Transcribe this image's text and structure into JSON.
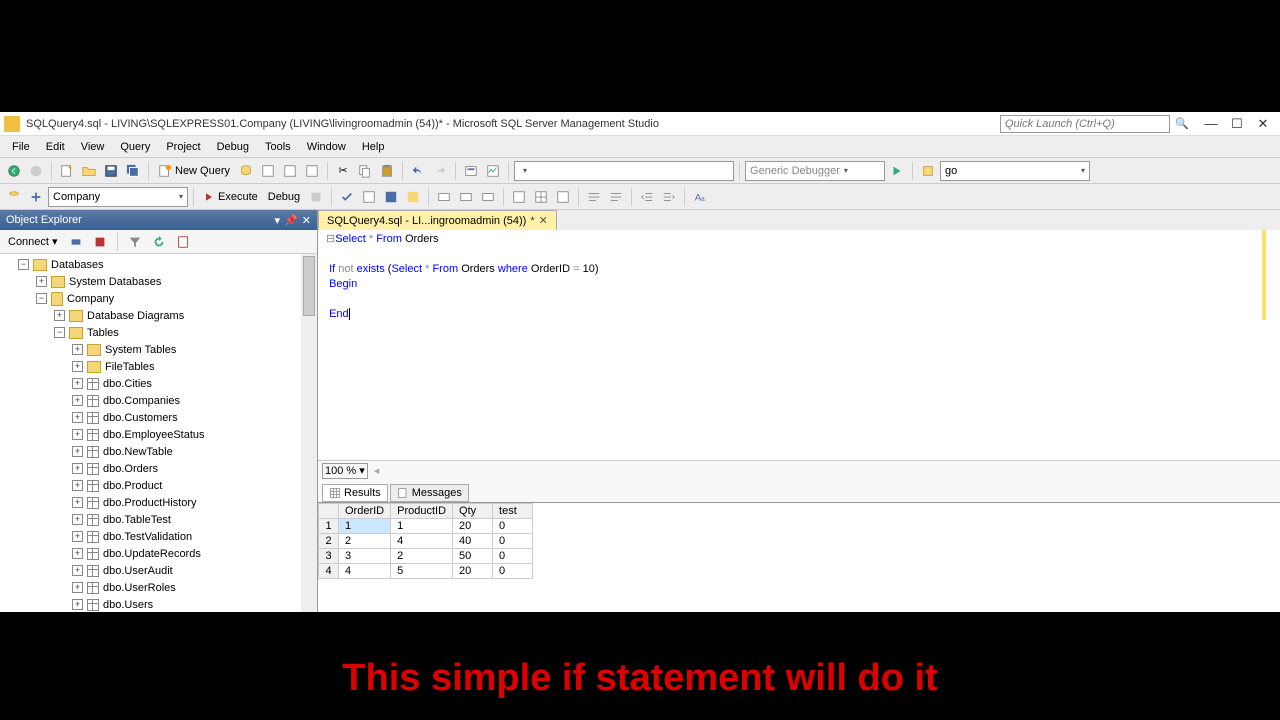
{
  "title": "SQLQuery4.sql - LIVING\\SQLEXPRESS01.Company (LIVING\\livingroomadmin (54))* - Microsoft SQL Server Management Studio",
  "quick_launch": "Quick Launch (Ctrl+Q)",
  "menus": [
    "File",
    "Edit",
    "View",
    "Query",
    "Project",
    "Debug",
    "Tools",
    "Window",
    "Help"
  ],
  "toolbar": {
    "new_query": "New Query",
    "debugger": "Generic Debugger",
    "go_box": "go"
  },
  "toolbar2": {
    "db_combo": "Company",
    "execute": "Execute",
    "debug": "Debug"
  },
  "panel": {
    "title": "Object Explorer",
    "connect": "Connect"
  },
  "tree": {
    "root": "Databases",
    "sysdb": "System Databases",
    "company": "Company",
    "diagrams": "Database Diagrams",
    "tables": "Tables",
    "systables": "System Tables",
    "filetables": "FileTables",
    "items": [
      "dbo.Cities",
      "dbo.Companies",
      "dbo.Customers",
      "dbo.EmployeeStatus",
      "dbo.NewTable",
      "dbo.Orders",
      "dbo.Product",
      "dbo.ProductHistory",
      "dbo.TableTest",
      "dbo.TestValidation",
      "dbo.UpdateRecords",
      "dbo.UserAudit",
      "dbo.UserRoles",
      "dbo.Users"
    ]
  },
  "tab": {
    "label": "SQLQuery4.sql - LI...ingroomadmin (54))",
    "dirty": "*"
  },
  "sql": {
    "line1_a": "Select",
    "line1_b": "*",
    "line1_c": "From",
    "line1_d": "Orders",
    "line3_a": "If",
    "line3_b": "not",
    "line3_c": "exists",
    "line3_d": "Select",
    "line3_e": "*",
    "line3_f": "From",
    "line3_g": "Orders",
    "line3_h": "where",
    "line3_i": "OrderID",
    "line3_j": "=",
    "line3_k": "10",
    "line4": "Begin",
    "line6": "End"
  },
  "zoom": "100 %",
  "rtabs": {
    "results": "Results",
    "messages": "Messages"
  },
  "grid_headers": [
    "OrderID",
    "ProductID",
    "Qty",
    "test"
  ],
  "chart_data": {
    "type": "table",
    "columns": [
      "OrderID",
      "ProductID",
      "Qty",
      "test"
    ],
    "rows": [
      [
        1,
        1,
        20,
        0
      ],
      [
        2,
        4,
        40,
        0
      ],
      [
        3,
        2,
        50,
        0
      ],
      [
        4,
        5,
        20,
        0
      ]
    ]
  },
  "caption": "This simple if statement will do it"
}
